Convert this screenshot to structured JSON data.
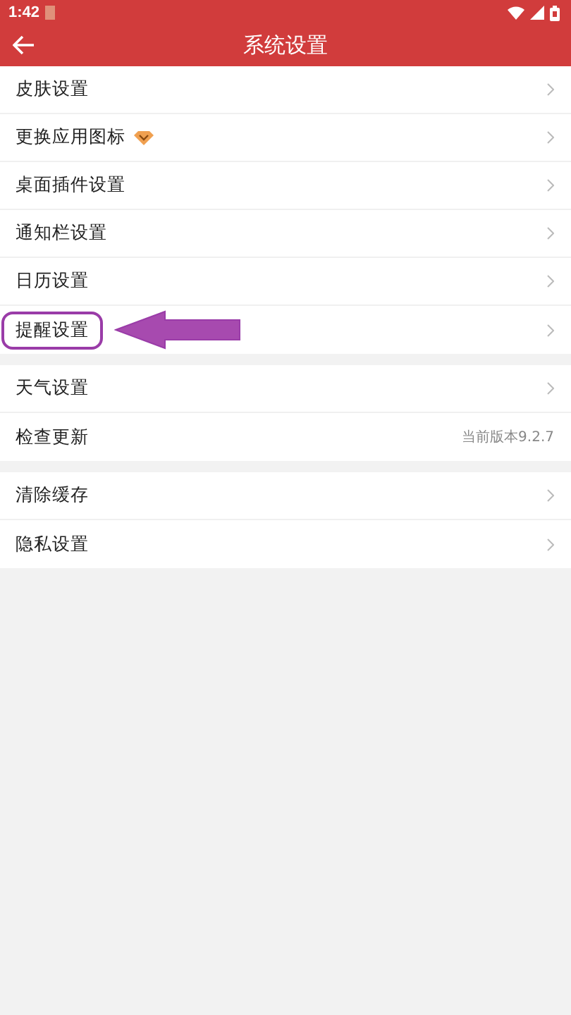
{
  "status_bar": {
    "time": "1:42"
  },
  "header": {
    "title": "系统设置"
  },
  "groups": [
    {
      "items": [
        {
          "kind": "link",
          "label": "皮肤设置",
          "badge": false,
          "highlighted": false
        },
        {
          "kind": "link",
          "label": "更换应用图标",
          "badge": true,
          "highlighted": false
        },
        {
          "kind": "link",
          "label": "桌面插件设置",
          "badge": false,
          "highlighted": false
        },
        {
          "kind": "link",
          "label": "通知栏设置",
          "badge": false,
          "highlighted": false
        },
        {
          "kind": "link",
          "label": "日历设置",
          "badge": false,
          "highlighted": false
        },
        {
          "kind": "link",
          "label": "提醒设置",
          "badge": false,
          "highlighted": true
        }
      ]
    },
    {
      "items": [
        {
          "kind": "link",
          "label": "天气设置",
          "badge": false,
          "highlighted": false
        },
        {
          "kind": "value",
          "label": "检查更新",
          "value": "当前版本9.2.7",
          "badge": false,
          "highlighted": false
        }
      ]
    },
    {
      "items": [
        {
          "kind": "link",
          "label": "清除缓存",
          "badge": false,
          "highlighted": false
        },
        {
          "kind": "link",
          "label": "隐私设置",
          "badge": false,
          "highlighted": false
        }
      ]
    }
  ]
}
